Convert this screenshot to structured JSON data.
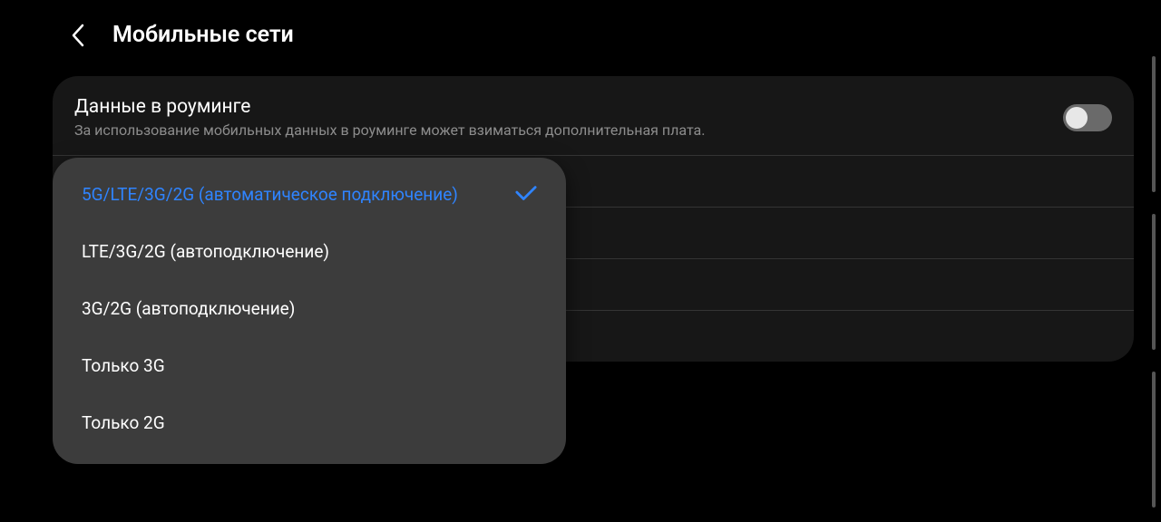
{
  "header": {
    "title": "Мобильные сети"
  },
  "roaming": {
    "title": "Данные в роуминге",
    "subtitle": "За использование мобильных данных в роуминге может взиматься дополнительная плата.",
    "enabled": false
  },
  "popup": {
    "options": [
      {
        "label": "5G/LTE/3G/2G (автоматическое подключение)",
        "selected": true
      },
      {
        "label": "LTE/3G/2G (автоподключение)",
        "selected": false
      },
      {
        "label": "3G/2G (автоподключение)",
        "selected": false
      },
      {
        "label": "Только 3G",
        "selected": false
      },
      {
        "label": "Только 2G",
        "selected": false
      }
    ]
  }
}
